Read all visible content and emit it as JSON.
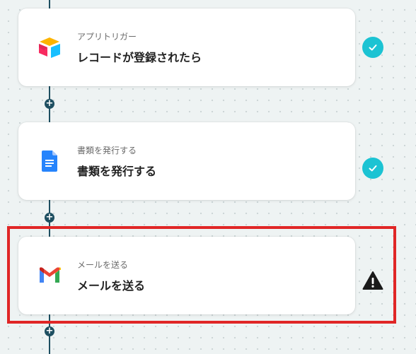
{
  "steps": [
    {
      "subtitle": "アプリトリガー",
      "title": "レコードが登録されたら",
      "icon": "airtable-icon",
      "status": "check-icon"
    },
    {
      "subtitle": "書類を発行する",
      "title": "書類を発行する",
      "icon": "google-docs-icon",
      "status": "check-icon"
    },
    {
      "subtitle": "メールを送る",
      "title": "メールを送る",
      "icon": "gmail-icon",
      "status": "warning-icon"
    }
  ],
  "add_label": "+",
  "colors": {
    "connector": "#1e4f61",
    "check": "#1cc3d3",
    "highlight": "#e02626",
    "warning": "#1a1a1a"
  }
}
